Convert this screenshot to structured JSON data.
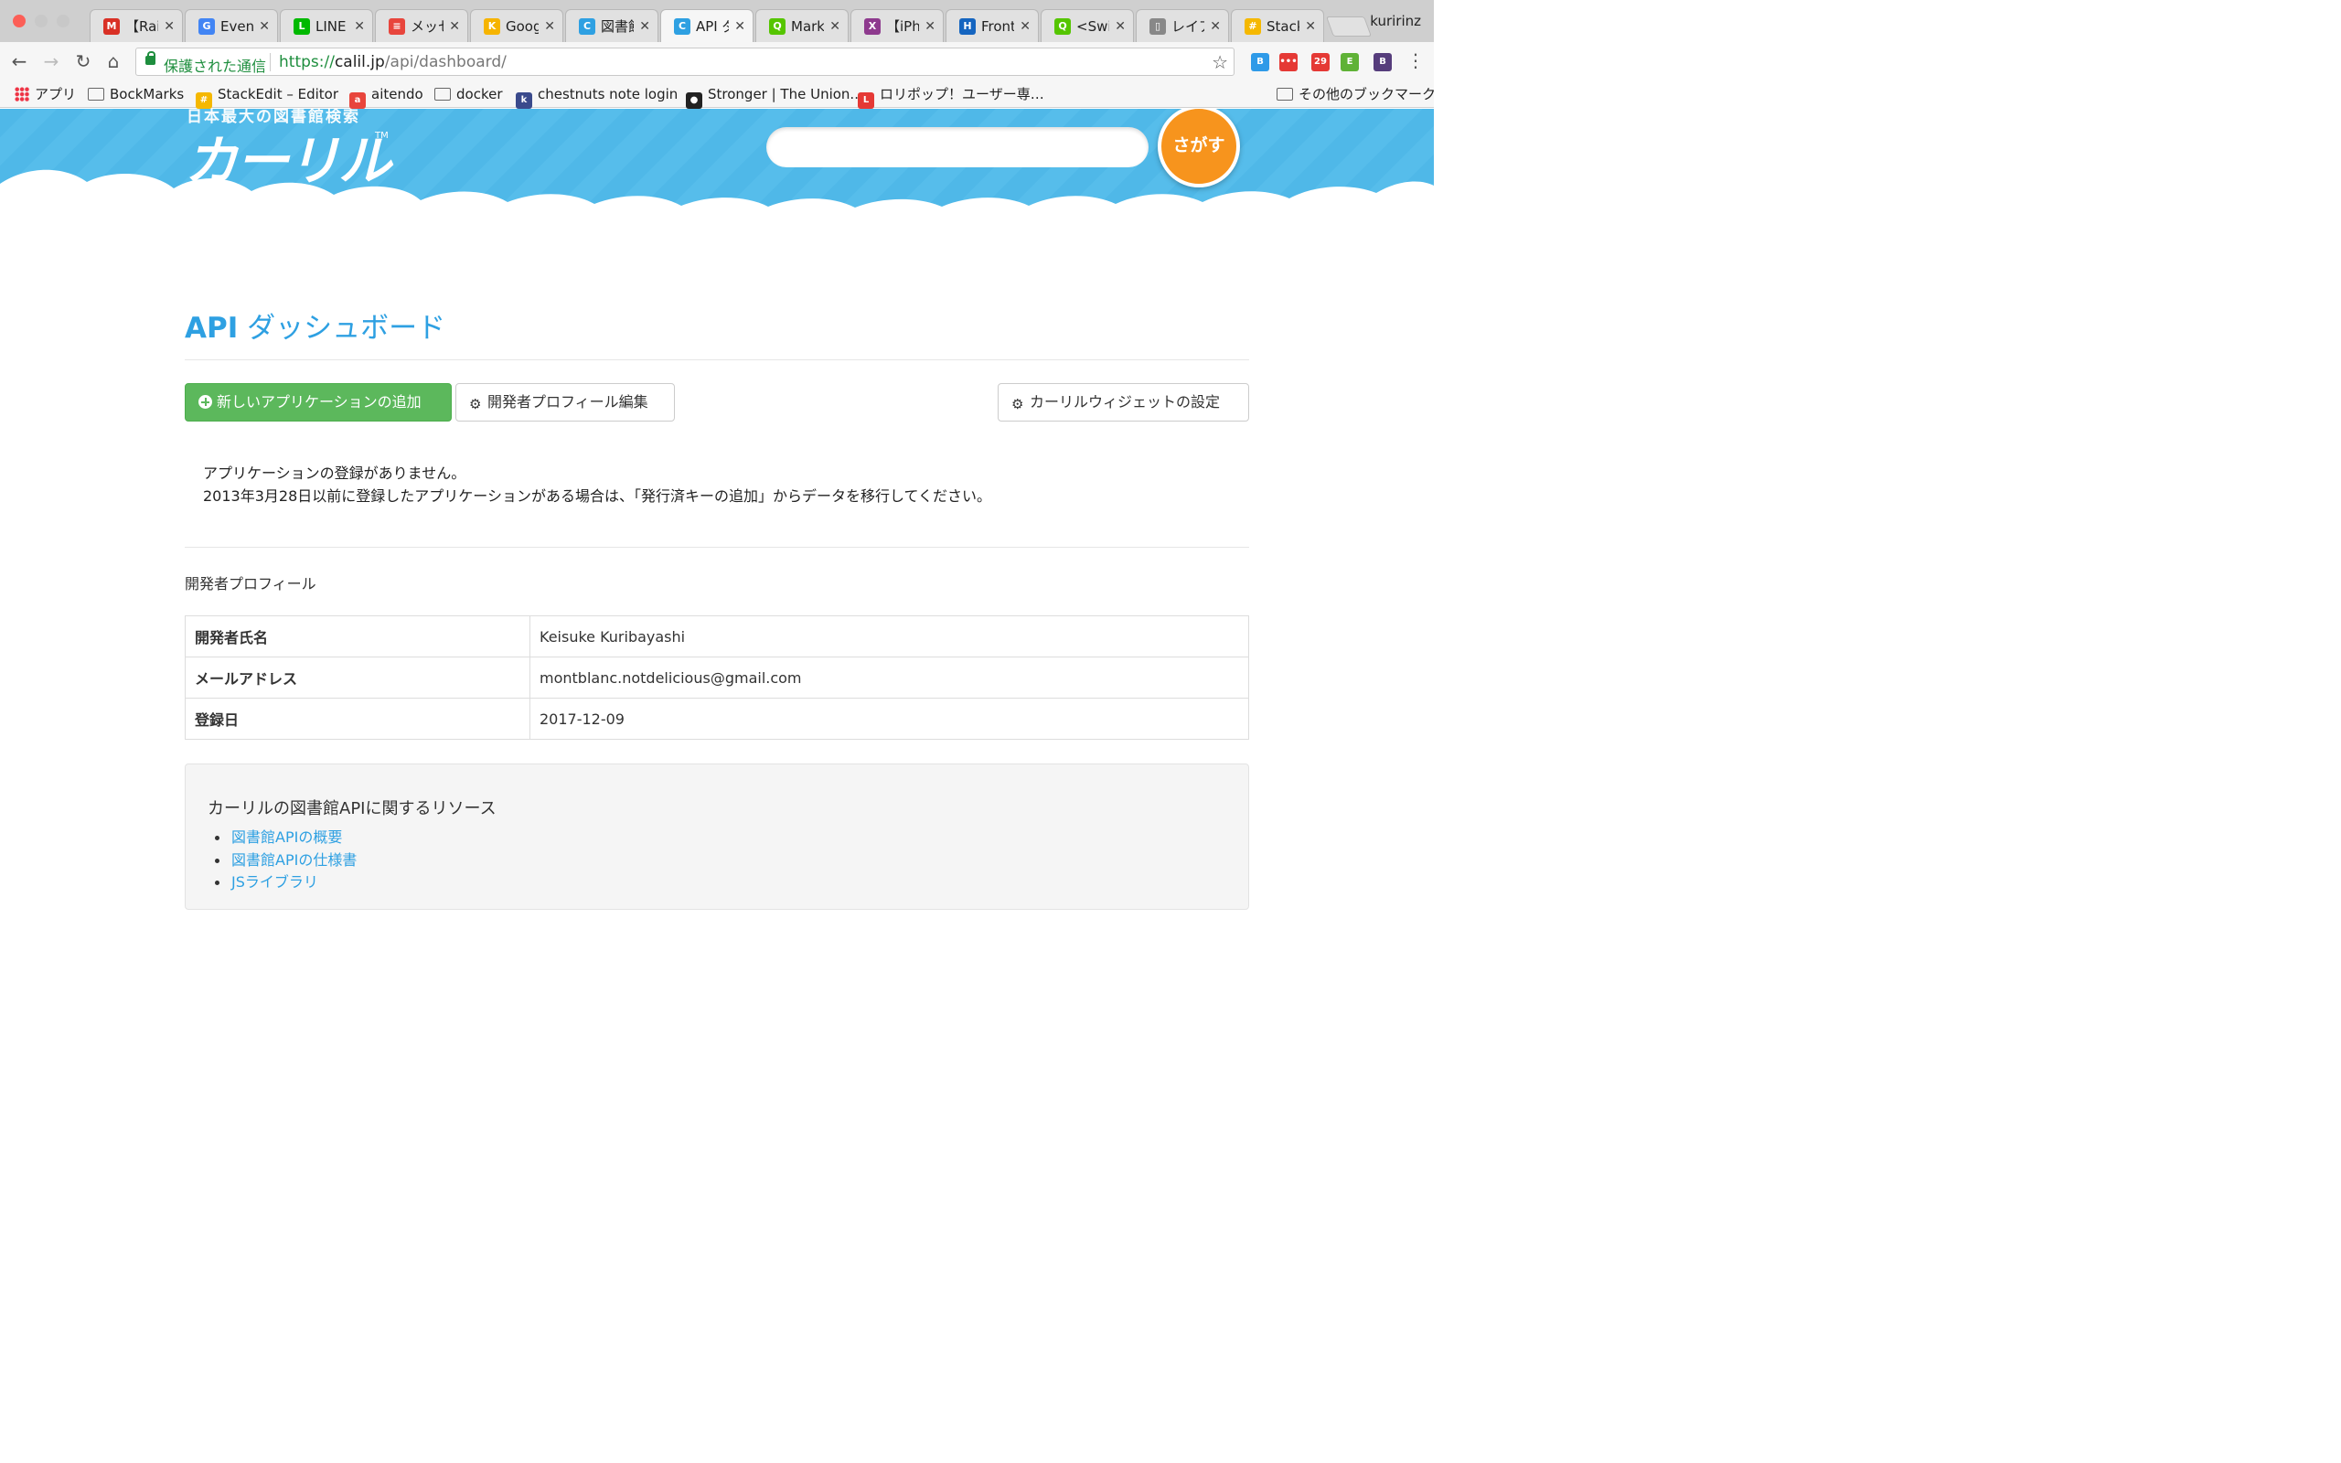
{
  "browser": {
    "tabs": [
      {
        "title": "【Rai",
        "icon": "gmail-icon",
        "color": "#d93025",
        "glyph": "M"
      },
      {
        "title": "Event",
        "icon": "google-icon",
        "color": "#4285f4",
        "glyph": "G"
      },
      {
        "title": "LINE I",
        "icon": "line-icon",
        "color": "#00b900",
        "glyph": "L"
      },
      {
        "title": "メッセ",
        "icon": "doc-icon",
        "color": "#e8453c",
        "glyph": "≡"
      },
      {
        "title": "Goog",
        "icon": "keep-icon",
        "color": "#f6b400",
        "glyph": "K"
      },
      {
        "title": "図書館",
        "icon": "calil-icon",
        "color": "#2ea0e2",
        "glyph": "C"
      },
      {
        "title": "API ダ",
        "icon": "calil-icon",
        "color": "#2ea0e2",
        "glyph": "C"
      },
      {
        "title": "Marko",
        "icon": "qiita-icon",
        "color": "#55c500",
        "glyph": "Q"
      },
      {
        "title": "【iPho",
        "icon": "xe-icon",
        "color": "#8e3a8e",
        "glyph": "X"
      },
      {
        "title": "Front",
        "icon": "h-icon",
        "color": "#1565c0",
        "glyph": "H"
      },
      {
        "title": "<Swif",
        "icon": "qiita-icon",
        "color": "#55c500",
        "glyph": "Q"
      },
      {
        "title": "レイア",
        "icon": "page-icon",
        "color": "#888888",
        "glyph": "▯"
      },
      {
        "title": "Stack",
        "icon": "stackedit-icon",
        "color": "#f5b800",
        "glyph": "#"
      }
    ],
    "active_tab_index": 6,
    "profile_name": "kuririnz",
    "secure_label": "保護された通信",
    "url_scheme": "https://",
    "url_host": "calil.jp",
    "url_path": "/api/dashboard/",
    "bookmarks": [
      {
        "label": "アプリ",
        "type": "apps"
      },
      {
        "label": "BockMarks",
        "type": "folder"
      },
      {
        "label": "StackEdit – Editor",
        "type": "fav",
        "color": "#f5b800",
        "glyph": "#"
      },
      {
        "label": "aitendo",
        "type": "fav",
        "color": "#e8453c",
        "glyph": "a"
      },
      {
        "label": "docker",
        "type": "folder"
      },
      {
        "label": "chestnuts note login",
        "type": "fav",
        "color": "#3a4a8c",
        "glyph": "k"
      },
      {
        "label": "Stronger | The Union..",
        "type": "fav",
        "color": "#222222",
        "glyph": "●"
      },
      {
        "label": "ロリポップ！ユーザー専…",
        "type": "fav",
        "color": "#e53935",
        "glyph": "L"
      }
    ],
    "other_bookmarks": "その他のブックマーク",
    "extensions": [
      {
        "name": "bookmark-ext-icon",
        "color": "#2e9ae8",
        "glyph": "B"
      },
      {
        "name": "dots-ext-icon",
        "color": "#e53935",
        "glyph": "•••"
      },
      {
        "name": "calendar-ext-icon",
        "color": "#e53935",
        "glyph": "29"
      },
      {
        "name": "evernote-ext-icon",
        "color": "#5fb236",
        "glyph": "E"
      },
      {
        "name": "bootstrap-ext-icon",
        "color": "#563d7c",
        "glyph": "B"
      }
    ]
  },
  "header": {
    "logo_subtitle": "日本最大の図書館検索",
    "logo_text": "カーリル",
    "logo_tm": "TM",
    "search_placeholder": "",
    "search_button": "さがす"
  },
  "page": {
    "title_prefix": "API",
    "title_rest": " ダッシュボード",
    "add_app_button": "新しいアプリケーションの追加",
    "edit_profile_button": "開発者プロフィール編集",
    "widget_settings_button": "カーリルウィジェットの設定",
    "notice_line1": "アプリケーションの登録がありません。",
    "notice_line2": "2013年3月28日以前に登録したアプリケーションがある場合は、「発行済キーの追加」からデータを移行してください。",
    "profile_section_title": "開発者プロフィール",
    "profile_rows": [
      {
        "key": "開発者氏名",
        "value": "Keisuke Kuribayashi"
      },
      {
        "key": "メールアドレス",
        "value": "montblanc.notdelicious@gmail.com"
      },
      {
        "key": "登録日",
        "value": "2017-12-09"
      }
    ],
    "resources_title": "カーリルの図書館APIに関するリソース",
    "resources_links": [
      "図書館APIの概要",
      "図書館APIの仕様書",
      "JSライブラリ"
    ]
  },
  "colors": {
    "accent": "#2ea0e2",
    "success": "#5cb85c",
    "search_button": "#f7941d",
    "header_sky": "#4fb8e8"
  }
}
